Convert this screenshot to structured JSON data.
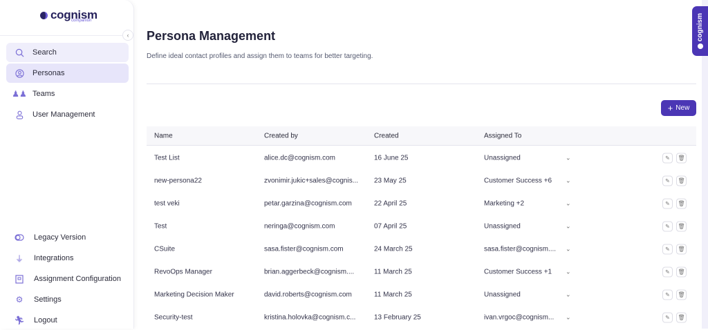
{
  "brand": {
    "name": "cognism",
    "sub": "companion",
    "accent": "#4b36b5"
  },
  "sidebar": {
    "top_items": [
      {
        "label": "Search",
        "icon": "search-icon"
      },
      {
        "label": "Personas",
        "icon": "user-circle-icon"
      },
      {
        "label": "Teams",
        "icon": "team-icon"
      },
      {
        "label": "User Management",
        "icon": "user-icon"
      }
    ],
    "bottom_items": [
      {
        "label": "Legacy Version",
        "icon": "toggle-icon"
      },
      {
        "label": "Integrations",
        "icon": "plug-icon"
      },
      {
        "label": "Assignment Configuration",
        "icon": "building-icon"
      },
      {
        "label": "Settings",
        "icon": "gear-icon"
      },
      {
        "label": "Logout",
        "icon": "logout-icon"
      }
    ]
  },
  "page": {
    "title": "Persona Management",
    "subtitle": "Define ideal contact profiles and assign them to teams for better targeting.",
    "new_label": "New"
  },
  "table": {
    "headers": [
      "Name",
      "Created by",
      "Created",
      "Assigned To"
    ],
    "rows": [
      {
        "name": "Test List",
        "created_by": "alice.dc@cognism.com",
        "created": "16 June 25",
        "assigned": "Unassigned"
      },
      {
        "name": "new-persona22",
        "created_by": "zvonimir.jukic+sales@cognis...",
        "created": "23 May 25",
        "assigned": "Customer Success +6"
      },
      {
        "name": "test veki",
        "created_by": "petar.garzina@cognism.com",
        "created": "22 April 25",
        "assigned": "Marketing +2"
      },
      {
        "name": "Test",
        "created_by": "neringa@cognism.com",
        "created": "07 April 25",
        "assigned": "Unassigned"
      },
      {
        "name": "CSuite",
        "created_by": "sasa.fister@cognism.com",
        "created": "24 March 25",
        "assigned": "sasa.fister@cognism...."
      },
      {
        "name": "RevoOps Manager",
        "created_by": "brian.aggerbeck@cognism....",
        "created": "11 March 25",
        "assigned": "Customer Success +1"
      },
      {
        "name": "Marketing Decision Maker",
        "created_by": "david.roberts@cognism.com",
        "created": "11 March 25",
        "assigned": "Unassigned"
      },
      {
        "name": "Security-test",
        "created_by": "kristina.holovka@cognism.c...",
        "created": "13 February 25",
        "assigned": "ivan.vrgoc@cognism..."
      }
    ]
  }
}
